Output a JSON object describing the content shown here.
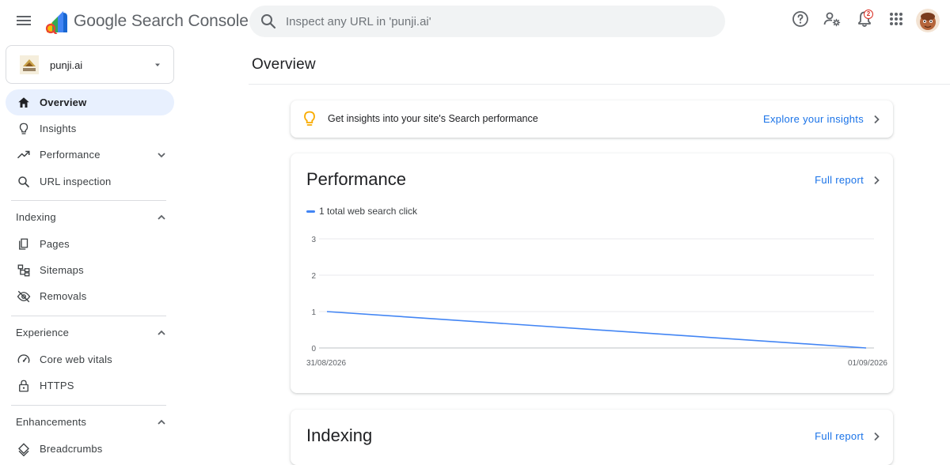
{
  "header": {
    "product_name": "Google Search Console",
    "search_placeholder": "Inspect any URL in 'punji.ai'",
    "notification_count": "2"
  },
  "sidebar": {
    "property": "punji.ai",
    "top_items": [
      {
        "label": "Overview",
        "icon": "home-icon",
        "active": true
      },
      {
        "label": "Insights",
        "icon": "lightbulb-icon"
      },
      {
        "label": "Performance",
        "icon": "trending-up-icon",
        "expandable": true
      },
      {
        "label": "URL inspection",
        "icon": "search-icon"
      }
    ],
    "sections": [
      {
        "title": "Indexing",
        "items": [
          {
            "label": "Pages",
            "icon": "pages-icon"
          },
          {
            "label": "Sitemaps",
            "icon": "sitemap-icon"
          },
          {
            "label": "Removals",
            "icon": "visibility-off-icon"
          }
        ]
      },
      {
        "title": "Experience",
        "items": [
          {
            "label": "Core web vitals",
            "icon": "speed-icon"
          },
          {
            "label": "HTTPS",
            "icon": "lock-icon"
          }
        ]
      },
      {
        "title": "Enhancements",
        "items": [
          {
            "label": "Breadcrumbs",
            "icon": "diamond-icon"
          }
        ]
      }
    ]
  },
  "main": {
    "title": "Overview",
    "insights_card": {
      "text": "Get insights into your site's Search performance",
      "link": "Explore your insights"
    },
    "performance_card": {
      "title": "Performance",
      "link": "Full report",
      "legend": "1 total web search click"
    },
    "indexing_card": {
      "title": "Indexing",
      "link": "Full report"
    }
  },
  "colors": {
    "accent": "#1a73e8",
    "series": "#4285f4",
    "active_nav_bg": "#e8f0fe",
    "insight_icon": "#f9ab00"
  },
  "chart_data": {
    "type": "line",
    "x": [
      "31/08/2026",
      "01/09/2026"
    ],
    "series": [
      {
        "values": [
          1,
          0
        ]
      }
    ],
    "xlabel": "",
    "ylabel": "",
    "yticks": [
      0,
      1,
      2,
      3
    ],
    "ylim": [
      0,
      3
    ],
    "grid": true
  }
}
